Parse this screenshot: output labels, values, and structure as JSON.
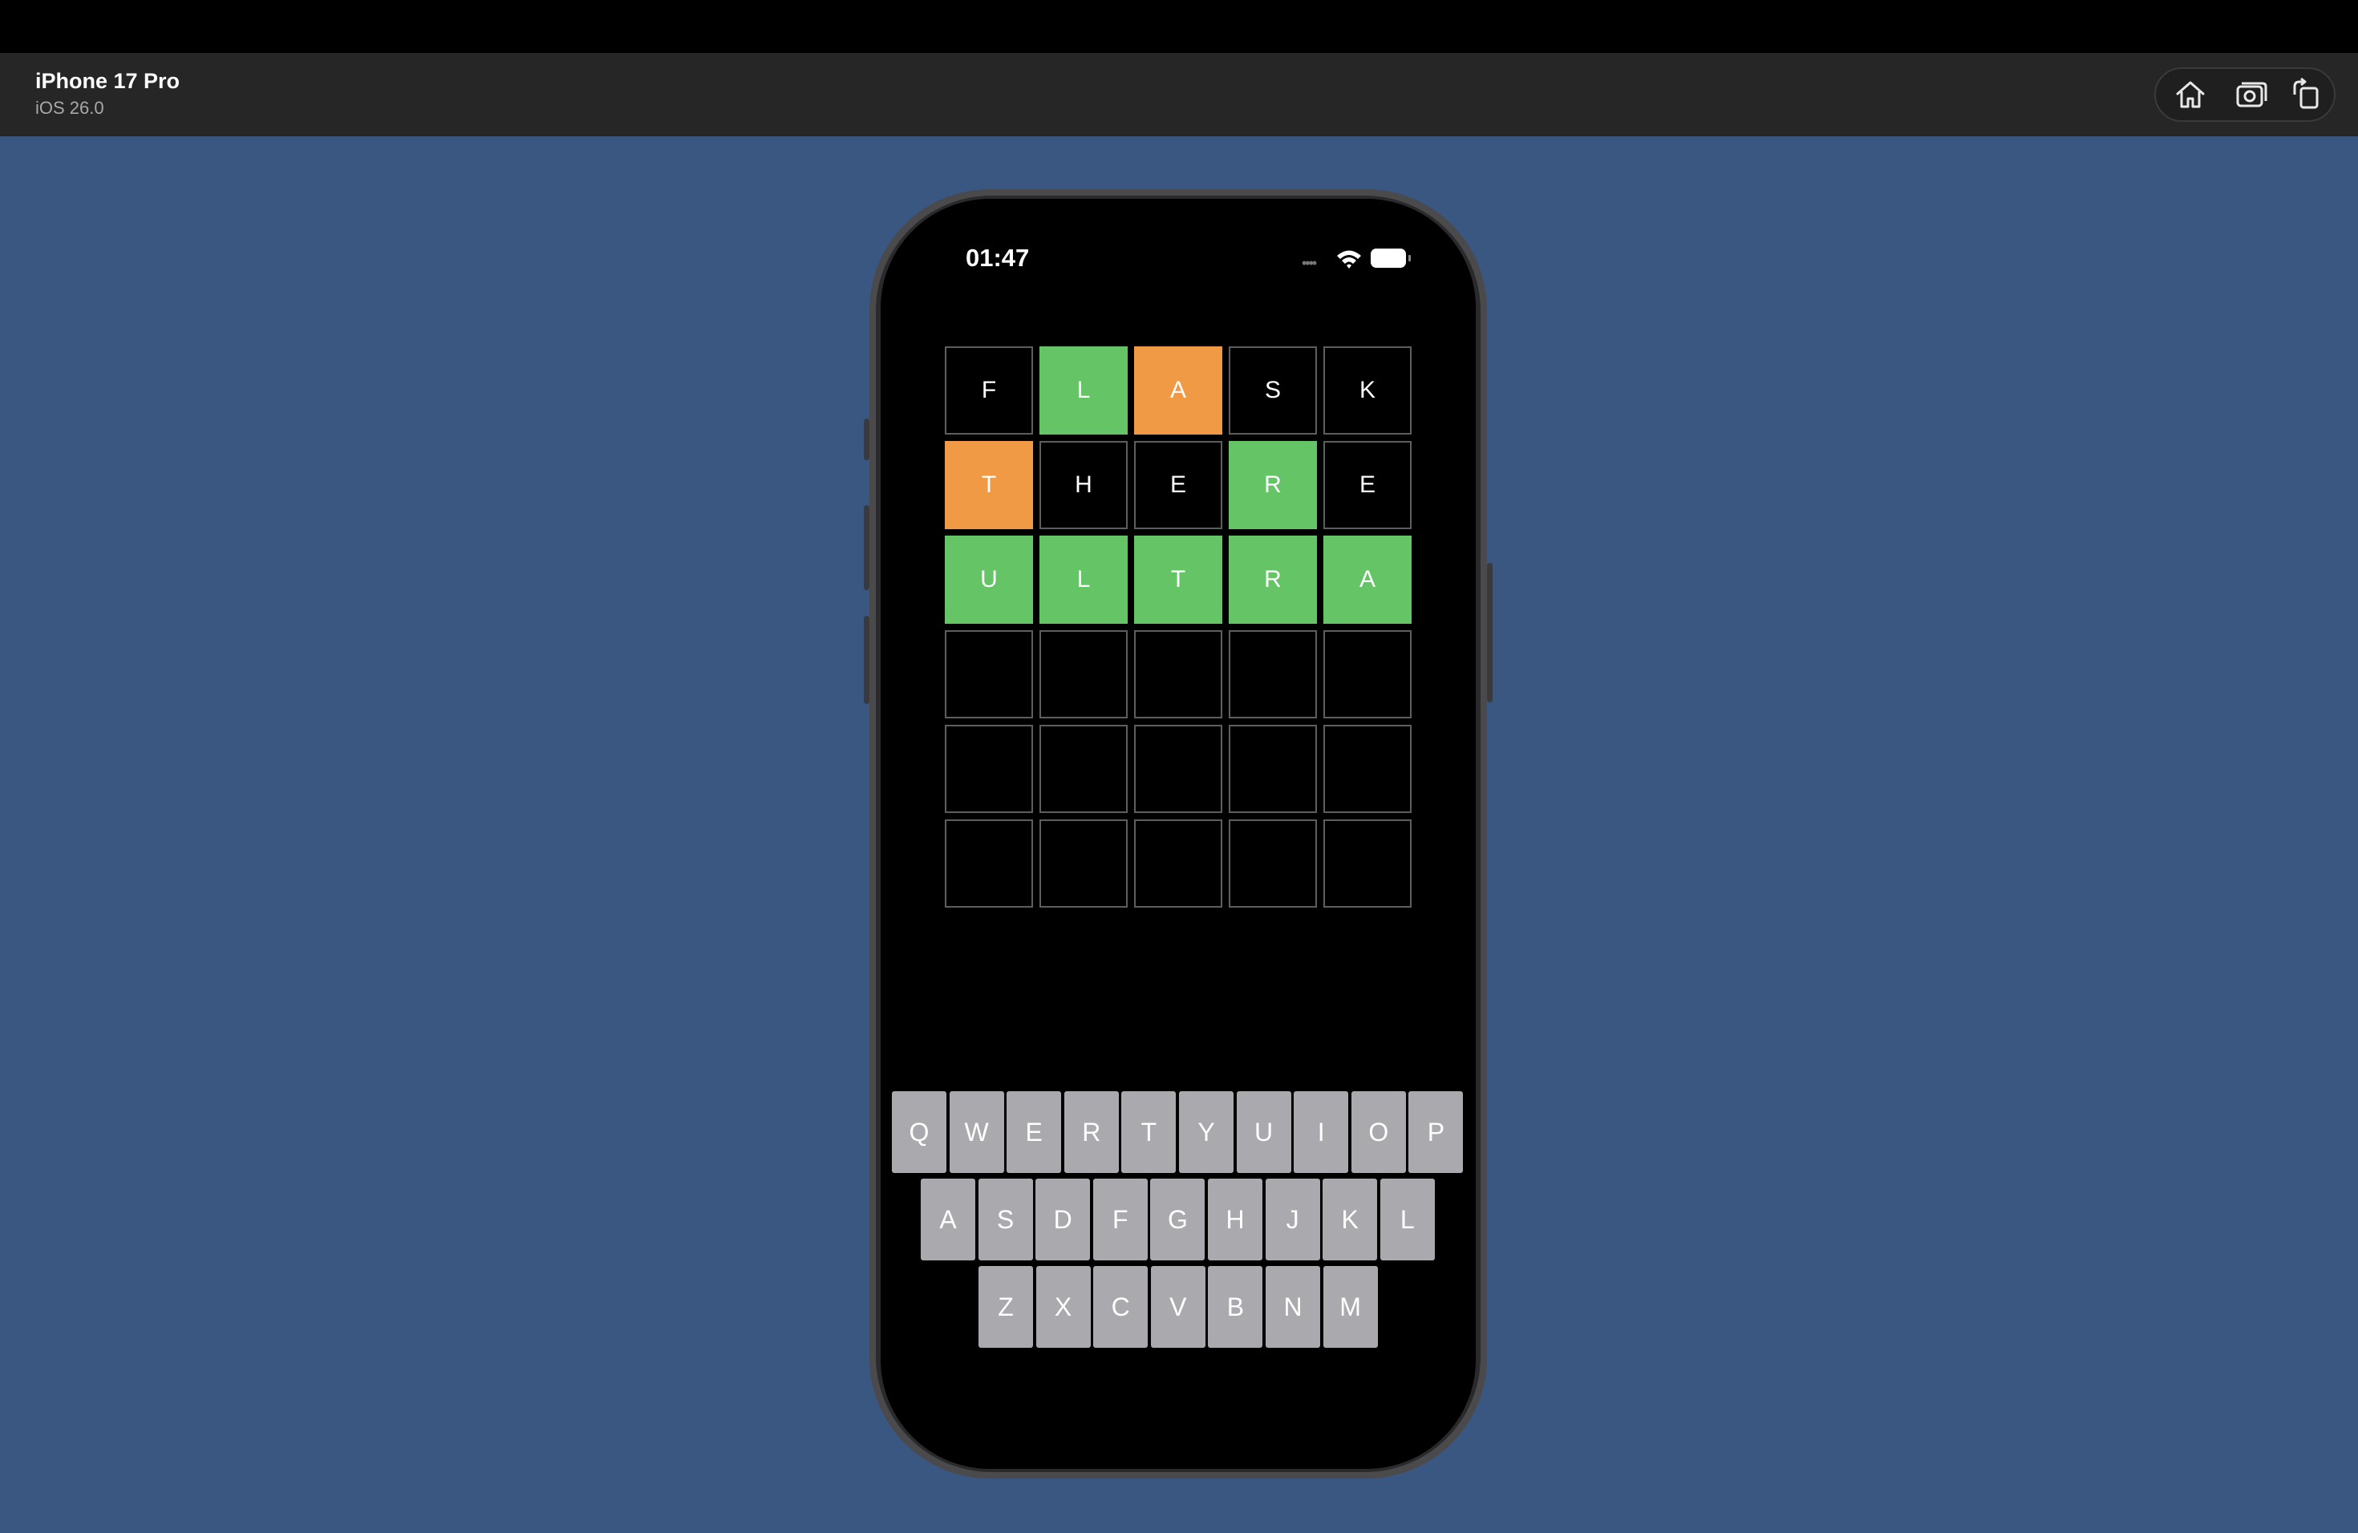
{
  "simulator": {
    "device_name": "iPhone 17 Pro",
    "os_version": "iOS 26.0",
    "toolbar_icons": [
      "home-icon",
      "screenshot-icon",
      "rotate-icon"
    ]
  },
  "status_bar": {
    "time": "01:47"
  },
  "board": {
    "rows": [
      [
        {
          "letter": "F",
          "state": "empty"
        },
        {
          "letter": "L",
          "state": "correct"
        },
        {
          "letter": "A",
          "state": "present"
        },
        {
          "letter": "S",
          "state": "empty"
        },
        {
          "letter": "K",
          "state": "empty"
        }
      ],
      [
        {
          "letter": "T",
          "state": "present"
        },
        {
          "letter": "H",
          "state": "empty"
        },
        {
          "letter": "E",
          "state": "empty"
        },
        {
          "letter": "R",
          "state": "correct"
        },
        {
          "letter": "E",
          "state": "empty"
        }
      ],
      [
        {
          "letter": "U",
          "state": "correct"
        },
        {
          "letter": "L",
          "state": "correct"
        },
        {
          "letter": "T",
          "state": "correct"
        },
        {
          "letter": "R",
          "state": "correct"
        },
        {
          "letter": "A",
          "state": "correct"
        }
      ],
      [
        {
          "letter": "",
          "state": "empty"
        },
        {
          "letter": "",
          "state": "empty"
        },
        {
          "letter": "",
          "state": "empty"
        },
        {
          "letter": "",
          "state": "empty"
        },
        {
          "letter": "",
          "state": "empty"
        }
      ],
      [
        {
          "letter": "",
          "state": "empty"
        },
        {
          "letter": "",
          "state": "empty"
        },
        {
          "letter": "",
          "state": "empty"
        },
        {
          "letter": "",
          "state": "empty"
        },
        {
          "letter": "",
          "state": "empty"
        }
      ],
      [
        {
          "letter": "",
          "state": "empty"
        },
        {
          "letter": "",
          "state": "empty"
        },
        {
          "letter": "",
          "state": "empty"
        },
        {
          "letter": "",
          "state": "empty"
        },
        {
          "letter": "",
          "state": "empty"
        }
      ]
    ],
    "colors": {
      "correct": "#64c466",
      "present": "#f09a45",
      "empty": "#000000",
      "border": "#5e5e5e"
    }
  },
  "keyboard": {
    "rows": [
      [
        "Q",
        "W",
        "E",
        "R",
        "T",
        "Y",
        "U",
        "I",
        "O",
        "P"
      ],
      [
        "A",
        "S",
        "D",
        "F",
        "G",
        "H",
        "J",
        "K",
        "L"
      ],
      [
        "Z",
        "X",
        "C",
        "V",
        "B",
        "N",
        "M"
      ]
    ],
    "key_color": "#aaaaae"
  },
  "colors": {
    "desktop_background": "#3a5782",
    "toolbar_background": "#262626"
  }
}
